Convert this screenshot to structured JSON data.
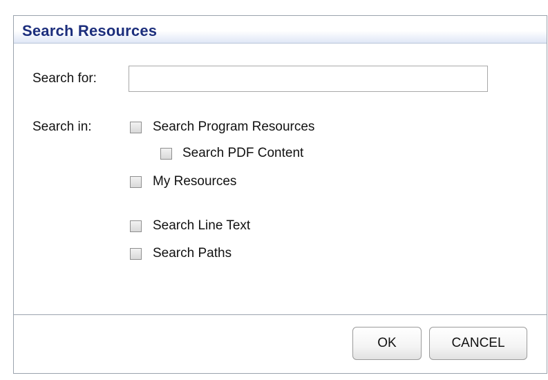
{
  "dialog": {
    "title": "Search Resources",
    "search_for_label": "Search for:",
    "search_value": "",
    "search_in_label": "Search in:",
    "options": [
      {
        "label": "Search Program Resources",
        "checked": false
      },
      {
        "label": "Search PDF Content",
        "checked": false
      },
      {
        "label": "My Resources",
        "checked": false
      },
      {
        "label": "Search Line Text",
        "checked": false
      },
      {
        "label": "Search Paths",
        "checked": false
      }
    ],
    "ok_label": "OK",
    "cancel_label": "CANCEL"
  }
}
